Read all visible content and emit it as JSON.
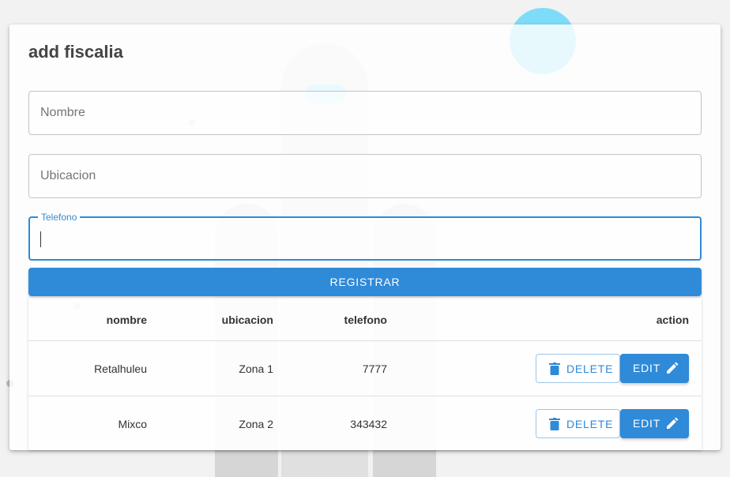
{
  "form": {
    "title": "add fiscalia",
    "fields": {
      "nombre": {
        "placeholder": "Nombre"
      },
      "ubicacion": {
        "placeholder": "Ubicacion"
      },
      "telefono": {
        "label": "Telefono",
        "value": ""
      }
    },
    "register_label": "REGISTRAR"
  },
  "table": {
    "headers": {
      "nombre": "nombre",
      "ubicacion": "ubicacion",
      "telefono": "telefono",
      "action": "action"
    },
    "rows": [
      {
        "nombre": "Retalhuleu",
        "ubicacion": "Zona 1",
        "telefono": "7777",
        "delete_label": "DELETE",
        "edit_label": "EDIT"
      },
      {
        "nombre": "Mixco",
        "ubicacion": "Zona 2",
        "telefono": "343432",
        "delete_label": "DELETE",
        "edit_label": "EDIT"
      }
    ]
  },
  "icons": {
    "delete": "trash-icon",
    "edit": "pencil-icon"
  },
  "colors": {
    "accent": "#2f8ad8",
    "background": "#f2f2f2"
  }
}
